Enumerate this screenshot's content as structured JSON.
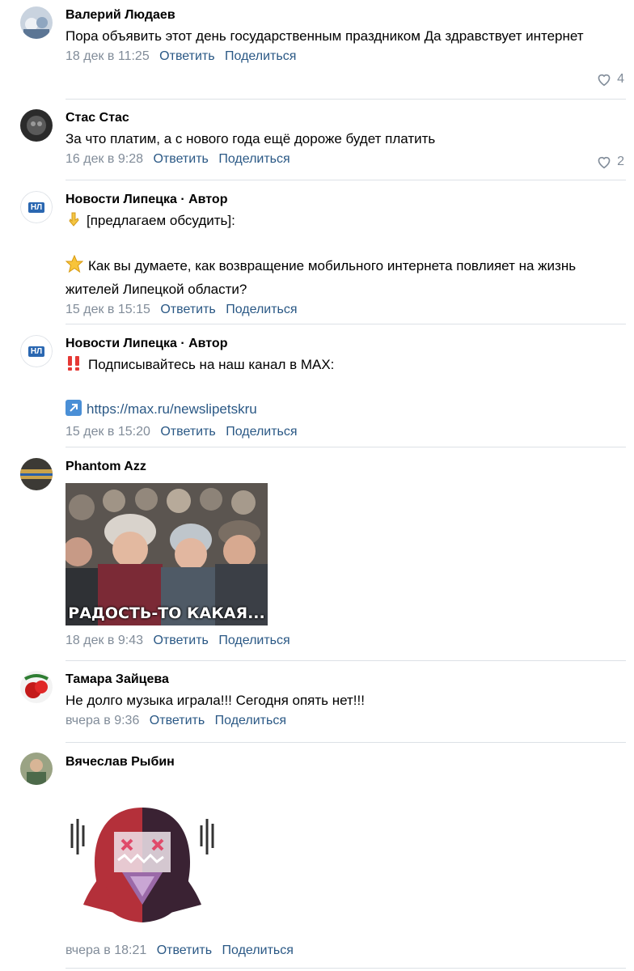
{
  "comments": [
    {
      "author": "Валерий Людаев",
      "text": "Пора объявить этот день государственным праздником Да здравствует интернет",
      "date": "18 дек в 11:25",
      "reply": "Ответить",
      "share": "Поделиться",
      "likes": "4"
    },
    {
      "author": "Стас Стас",
      "text": "За что платим, а с нового года ещё дороже будет платить",
      "date": "16 дек в 9:28",
      "reply": "Ответить",
      "share": "Поделиться",
      "likes": "2"
    },
    {
      "author": "Новости Липецка · Автор",
      "avatar_text": "НЛ",
      "line1": "[предлагаем обсудить]:",
      "line2": "Как вы думаете, как возвращение мобильного интернета повлияет на жизнь жителей Липецкой области?",
      "date": "15 дек в 15:15",
      "reply": "Ответить",
      "share": "Поделиться"
    },
    {
      "author": "Новости Липецка · Автор",
      "avatar_text": "НЛ",
      "line1": "Подписывайтесь на наш канал в MAX:",
      "link": "https://max.ru/newslipetskru",
      "date": "15 дек в 15:20",
      "reply": "Ответить",
      "share": "Поделиться"
    },
    {
      "author": "Phantom Azz",
      "image_caption": "РАДОСТЬ-ТО КАКАЯ...",
      "date": "18 дек в 9:43",
      "reply": "Ответить",
      "share": "Поделиться"
    },
    {
      "author": "Тамара Зайцева",
      "text": "Не долго музыка играла!!! Сегодня опять нет!!!",
      "date": "вчера в 9:36",
      "reply": "Ответить",
      "share": "Поделиться"
    },
    {
      "author": "Вячеслав Рыбин",
      "sticker": "anime-girl-sticker",
      "date": "вчера в 18:21",
      "reply": "Ответить",
      "share": "Поделиться"
    }
  ],
  "colors": {
    "link": "#2a5885",
    "meta": "#818c99",
    "divider": "#dce1e6"
  },
  "icons": {
    "like": "heart-outline-icon",
    "point": "point-down-emoji",
    "star": "star-emoji",
    "alert": "double-exclamation-emoji",
    "arrow": "arrow-up-right-emoji"
  }
}
